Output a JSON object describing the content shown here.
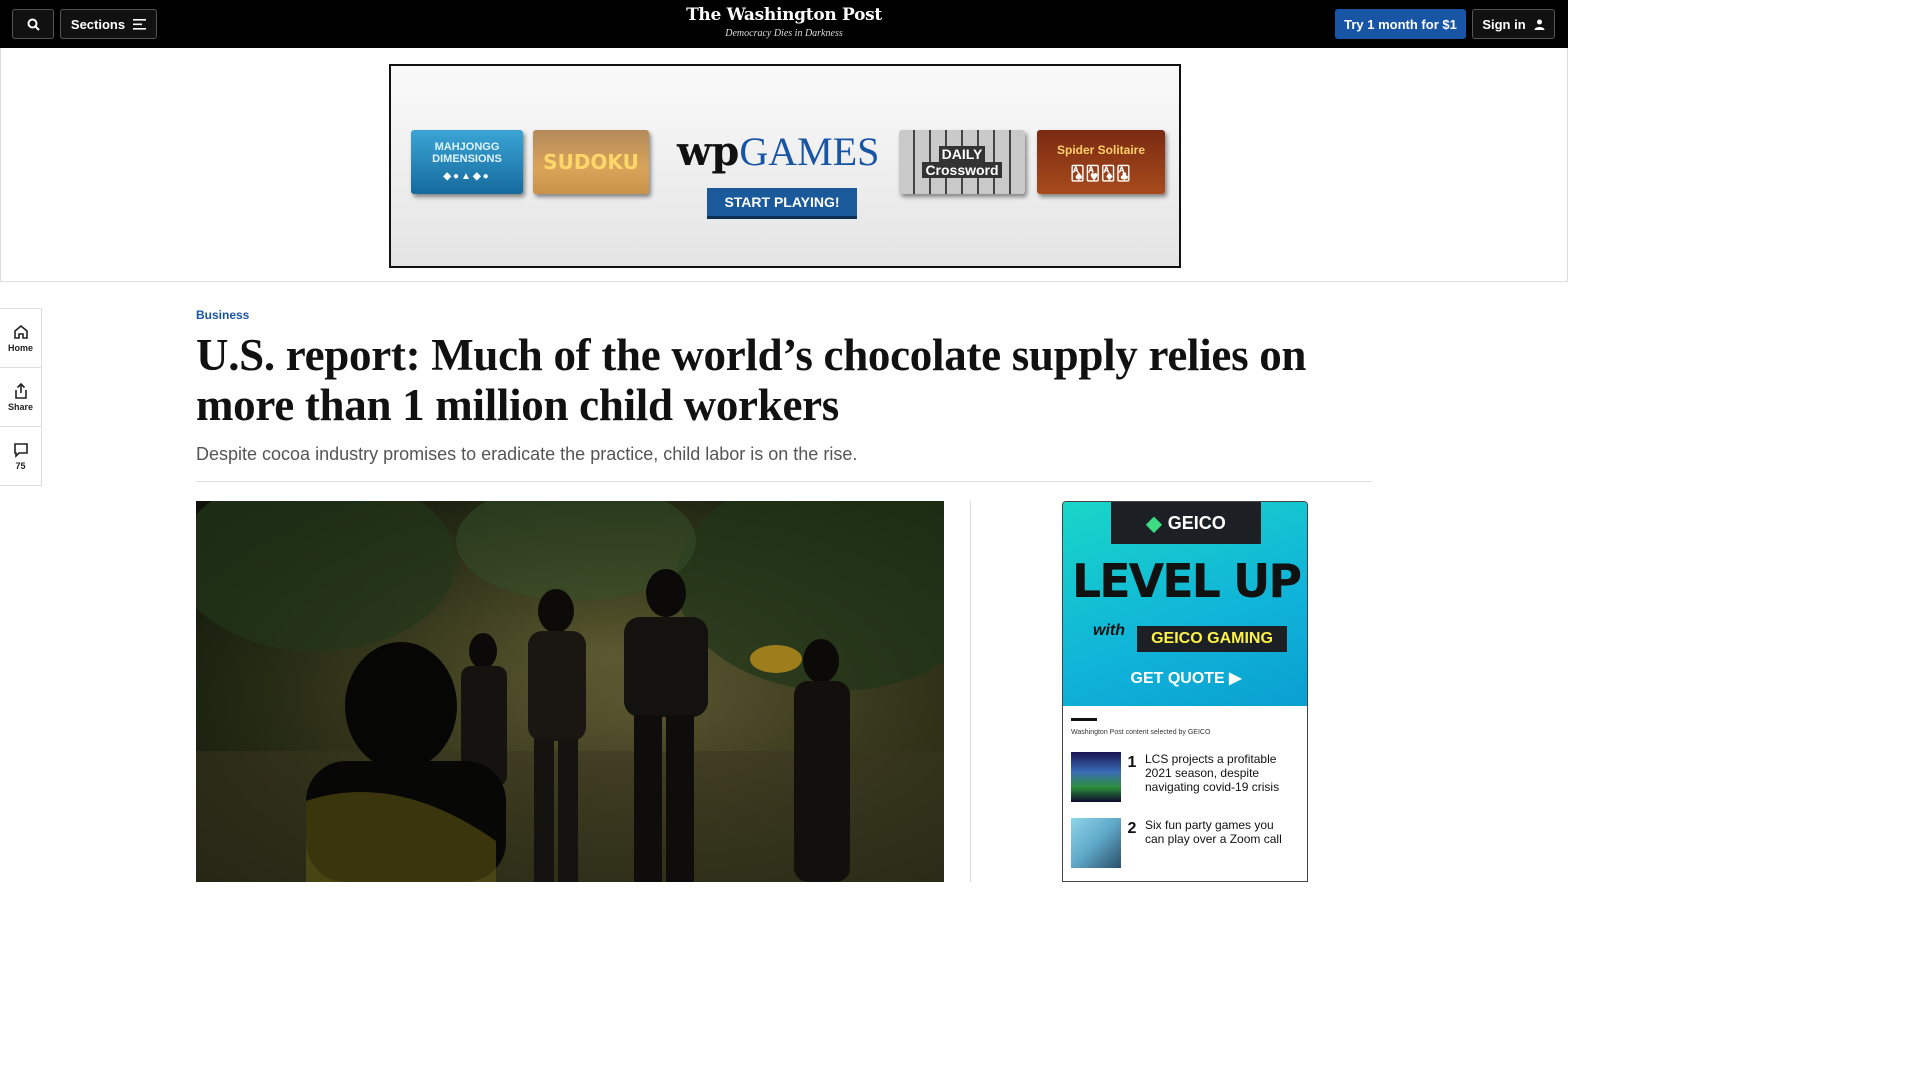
{
  "header": {
    "search_label": "",
    "sections_label": "Sections",
    "logo_name": "The Washington Post",
    "logo_tagline": "Democracy Dies in Darkness",
    "subscribe_label": "Try 1 month for $1",
    "signin_label": "Sign in"
  },
  "banner_ad": {
    "tile_mahjongg_line1": "MAHJONGG",
    "tile_mahjongg_line2": "DIMENSIONS",
    "tile_sudoku": "SUDOKU",
    "wp_mark": "wp",
    "wp_games": "GAMES",
    "cta": "START PLAYING!",
    "tile_crossword_line1": "DAILY",
    "tile_crossword_line2": "Crossword",
    "tile_spider": "Spider Solitaire"
  },
  "rail": {
    "home_label": "Home",
    "share_label": "Share",
    "comments_count": "75"
  },
  "article": {
    "kicker": "Business",
    "headline": "U.S. report: Much of the world’s chocolate supply relies on more than 1 million child workers",
    "dek": "Despite cocoa industry promises to eradicate the practice, child labor is on the rise."
  },
  "sidebar_ad": {
    "brand": "GEICO",
    "brand_sub": "GAMING",
    "headline": "LEVEL UP",
    "with": "with",
    "brand_gaming": "GEICO GAMING",
    "cta": "GET QUOTE ▶",
    "selected_by": "Washington Post content selected by GEICO",
    "promos": [
      {
        "num": "1",
        "text": "LCS projects a profitable 2021 season, despite navigating covid-19 crisis"
      },
      {
        "num": "2",
        "text": "Six fun party games you can play over a Zoom call"
      }
    ]
  },
  "colors": {
    "accent_blue": "#1955a5",
    "topbar_bg": "#000000",
    "geico_cyan": "#19d6c8"
  }
}
